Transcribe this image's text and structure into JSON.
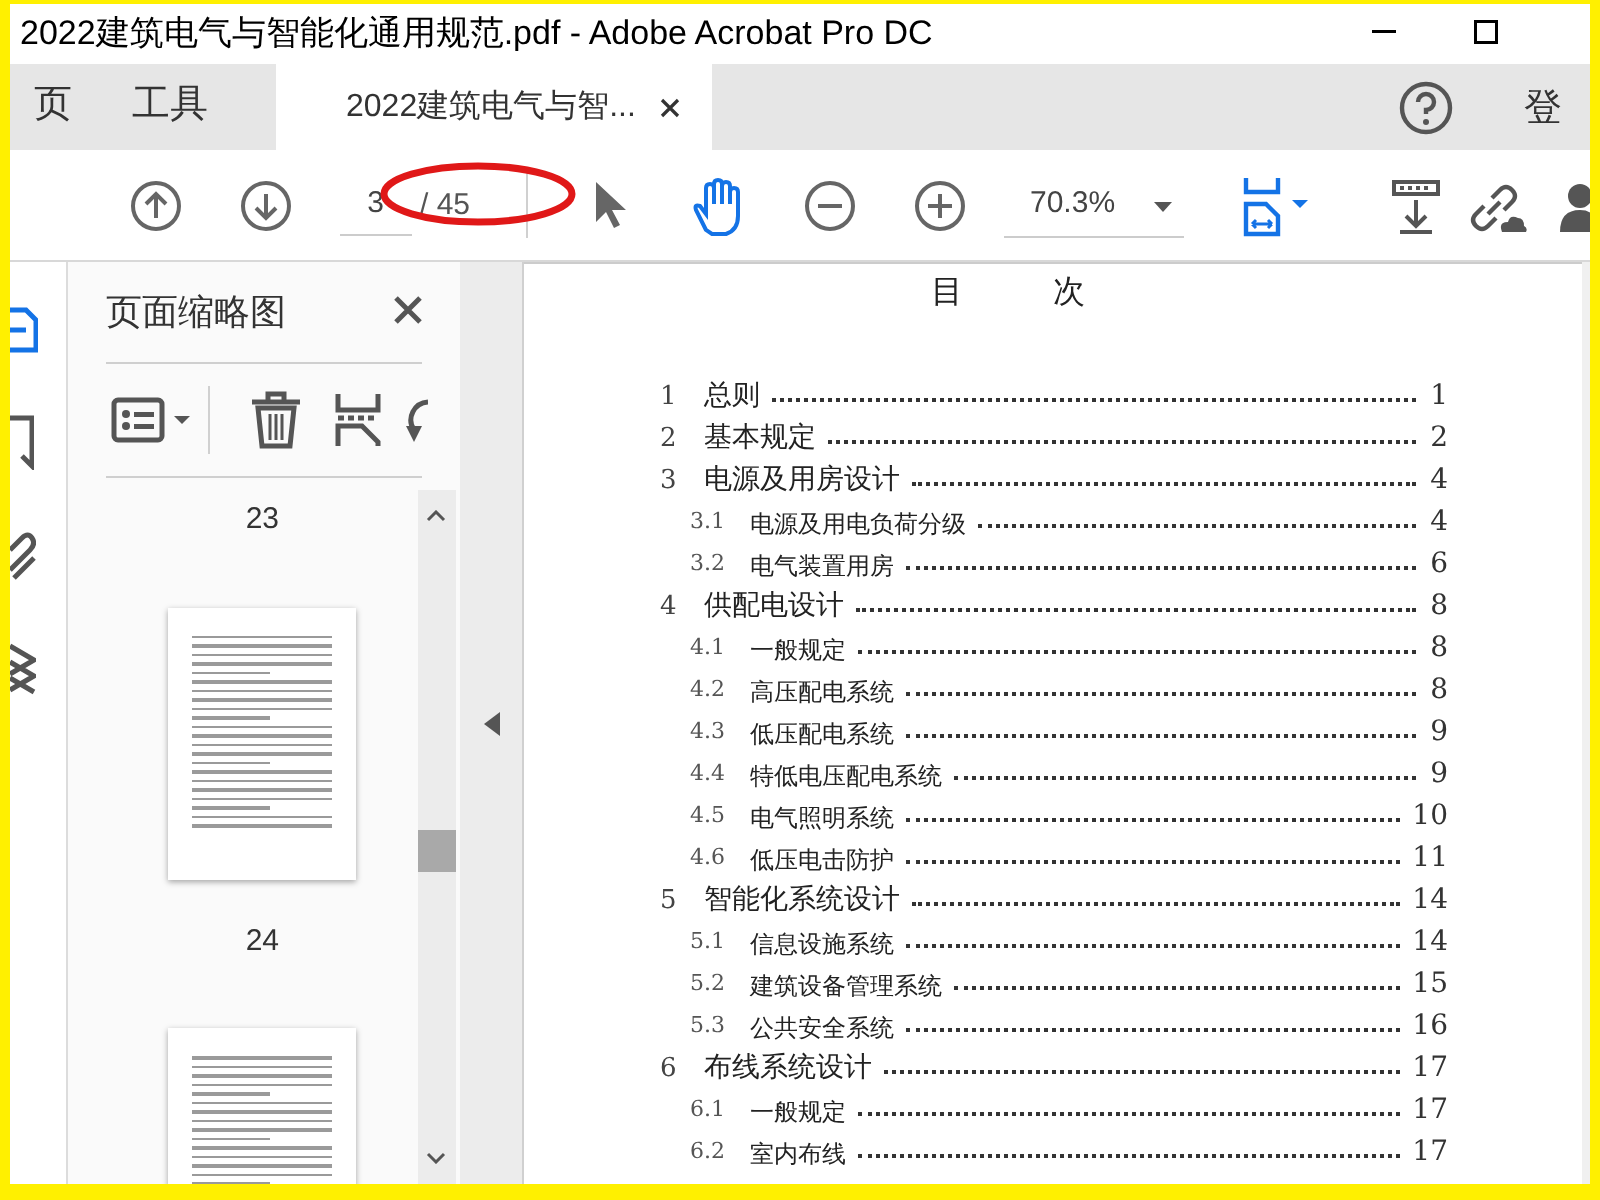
{
  "window": {
    "title": "2022建筑电气与智能化通用规范.pdf - Adobe Acrobat Pro DC"
  },
  "nav_tabs": [
    {
      "label": "页",
      "selected": false
    },
    {
      "label": "工具",
      "selected": false
    },
    {
      "label": "2022建筑电气与智...",
      "selected": true
    }
  ],
  "sign_in": "登",
  "toolbar": {
    "page": "3",
    "page_total": "/ 45",
    "tools": [
      {
        "kind": "select",
        "selected": false
      },
      {
        "kind": "hand",
        "selected": true
      }
    ],
    "zoom": "70.3%"
  },
  "sidebar_tools": [
    {
      "kind": "pages",
      "selected": true
    },
    {
      "kind": "bookmark",
      "selected": false
    },
    {
      "kind": "attachment",
      "selected": false
    },
    {
      "kind": "layers",
      "selected": false
    }
  ],
  "thumbnails_panel": {
    "title": "页面缩略图",
    "pages": [
      {
        "label": "23"
      },
      {
        "label": "24"
      }
    ]
  },
  "document": {
    "heading": "目 次",
    "toc": [
      {
        "number": "1",
        "title": "总则",
        "page": "1"
      },
      {
        "number": "2",
        "title": "基本规定",
        "page": "2"
      },
      {
        "number": "3",
        "title": "电源及用房设计",
        "page": "4",
        "children": [
          {
            "number": "3.1",
            "title": "电源及用电负荷分级",
            "page": "4"
          },
          {
            "number": "3.2",
            "title": "电气装置用房",
            "page": "6"
          }
        ]
      },
      {
        "number": "4",
        "title": "供配电设计",
        "page": "8",
        "children": [
          {
            "number": "4.1",
            "title": "一般规定",
            "page": "8"
          },
          {
            "number": "4.2",
            "title": "高压配电系统",
            "page": "8"
          },
          {
            "number": "4.3",
            "title": "低压配电系统",
            "page": "9"
          },
          {
            "number": "4.4",
            "title": "特低电压配电系统",
            "page": "9"
          },
          {
            "number": "4.5",
            "title": "电气照明系统",
            "page": "10"
          },
          {
            "number": "4.6",
            "title": "低压电击防护",
            "page": "11"
          }
        ]
      },
      {
        "number": "5",
        "title": "智能化系统设计",
        "page": "14",
        "children": [
          {
            "number": "5.1",
            "title": "信息设施系统",
            "page": "14"
          },
          {
            "number": "5.2",
            "title": "建筑设备管理系统",
            "page": "15"
          },
          {
            "number": "5.3",
            "title": "公共安全系统",
            "page": "16"
          }
        ]
      },
      {
        "number": "6",
        "title": "布线系统设计",
        "page": "17",
        "children": [
          {
            "number": "6.1",
            "title": "一般规定",
            "page": "17"
          },
          {
            "number": "6.2",
            "title": "室内布线",
            "page": "17"
          }
        ]
      }
    ]
  }
}
